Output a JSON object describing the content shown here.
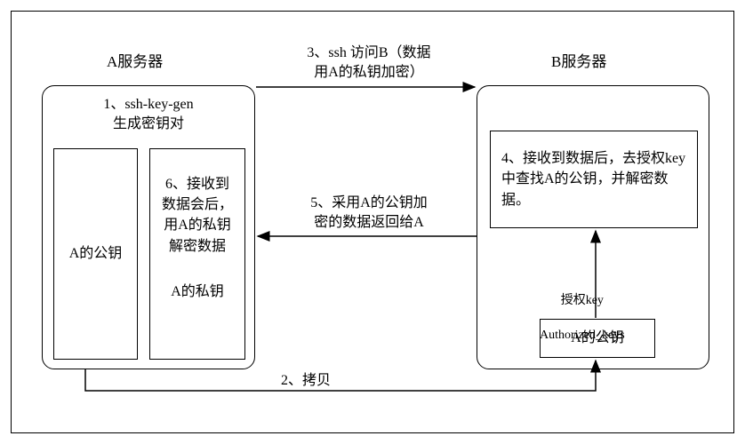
{
  "serverA": {
    "label": "A服务器",
    "step1": "1、ssh-key-gen\n生成密钥对",
    "pubkey": "A的公钥",
    "step6_line1": "6、接收到",
    "step6_line2": "数据会后，",
    "step6_line3": "用A的私钥",
    "step6_line4": "解密数据",
    "privkey": "A的私钥"
  },
  "serverB": {
    "label": "B服务器",
    "step4": "4、接收到数据后，去授权key中查找A的公钥，并解密数据。",
    "authkey_line1": "授权key",
    "authkey_line2": "Authorized_keys",
    "pubkey": "A的公钥"
  },
  "arrows": {
    "step3": "3、ssh 访问B（数据\n用A的私钥加密）",
    "step5": "5、采用A的公钥加\n密的数据返回给A",
    "step2": "2、拷贝"
  }
}
